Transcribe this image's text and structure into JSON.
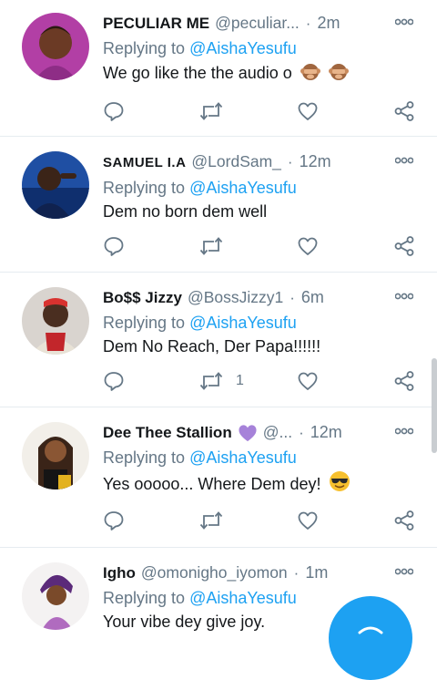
{
  "tweets": [
    {
      "name": "PECULIAR ME",
      "handle": "@peculiar...",
      "time": "2m",
      "reply_prefix": "Replying to ",
      "reply_to": "@AishaYesufu",
      "text": "We go like the the audio o",
      "emoji": [
        "see-no-evil-monkey",
        "see-no-evil-monkey"
      ],
      "retweets": "",
      "likes": ""
    },
    {
      "name": "SAMUEL I.A",
      "handle": "@LordSam_",
      "time": "12m",
      "reply_prefix": "Replying to ",
      "reply_to": "@AishaYesufu",
      "text": "Dem no born dem well",
      "retweets": "",
      "likes": ""
    },
    {
      "name": "Bo$$ Jizzy",
      "handle": "@BossJizzy1",
      "time": "6m",
      "reply_prefix": "Replying to ",
      "reply_to": "@AishaYesufu",
      "text": "Dem No Reach,  Der Papa!!!!!!",
      "retweets": "1",
      "likes": ""
    },
    {
      "name": "Dee Thee Stallion",
      "name_emoji": "purple-heart",
      "handle": "@...",
      "time": "12m",
      "reply_prefix": "Replying to ",
      "reply_to": "@AishaYesufu",
      "text": "Yes ooooo... Where Dem dey!",
      "emoji": [
        "smiling-face-with-sunglasses"
      ],
      "retweets": "",
      "likes": ""
    },
    {
      "name": "Igho",
      "handle": "@omonigho_iyomon",
      "time": "1m",
      "reply_prefix": "Replying to ",
      "reply_to": "@AishaYesufu",
      "text": "Your vibe dey give joy.",
      "retweets": "",
      "likes": ""
    }
  ],
  "separator": "·",
  "colors": {
    "accent": "#1da1f2",
    "muted": "#657786",
    "text": "#14171a",
    "divider": "#e6ecf0"
  },
  "icons": {
    "reply": "reply-icon",
    "retweet": "retweet-icon",
    "like": "heart-icon",
    "share": "share-icon",
    "more": "more-icon",
    "compose": "compose-icon"
  }
}
